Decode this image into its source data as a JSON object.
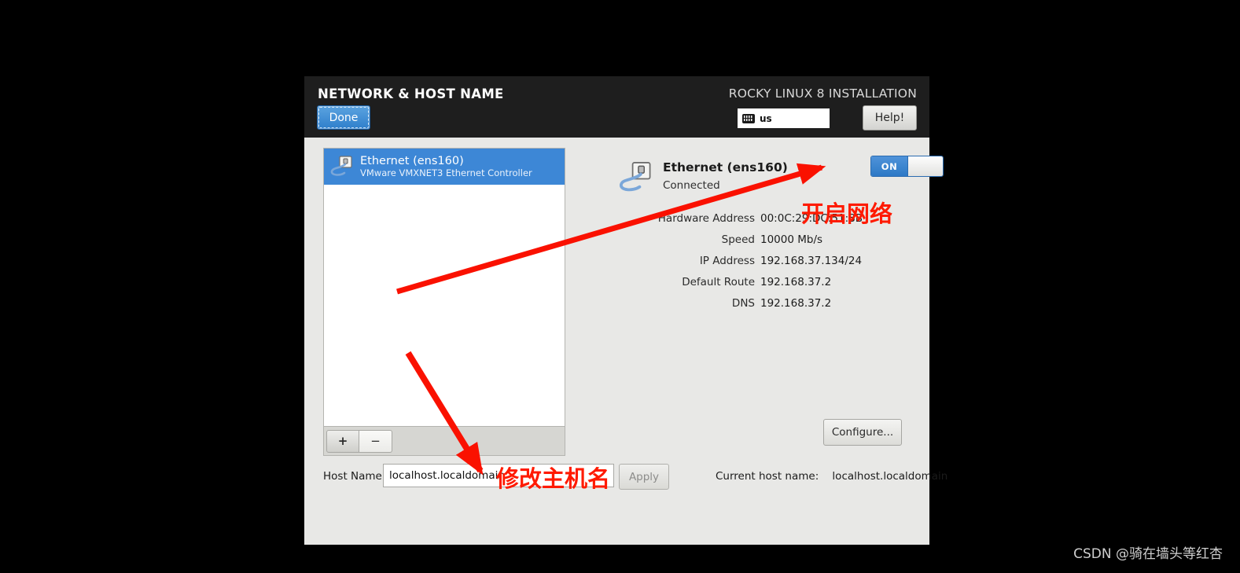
{
  "header": {
    "page_title": "NETWORK & HOST NAME",
    "done_label": "Done",
    "install_title": "ROCKY LINUX 8 INSTALLATION",
    "keyboard_layout": "us",
    "keyboard_icon": "keyboard-icon",
    "help_label": "Help!"
  },
  "device_list": {
    "devices": [
      {
        "name": "Ethernet (ens160)",
        "description": "VMware VMXNET3 Ethernet Controller",
        "icon": "ethernet-icon",
        "selected": true
      }
    ],
    "add_label": "+",
    "remove_label": "−"
  },
  "detail": {
    "icon": "ethernet-icon",
    "title": "Ethernet (ens160)",
    "status": "Connected",
    "toggle_state": "ON",
    "rows": [
      {
        "label": "Hardware Address",
        "value": "00:0C:29:DC:51:8B"
      },
      {
        "label": "Speed",
        "value": "10000 Mb/s"
      },
      {
        "label": "IP Address",
        "value": "192.168.37.134/24"
      },
      {
        "label": "Default Route",
        "value": "192.168.37.2"
      },
      {
        "label": "DNS",
        "value": "192.168.37.2"
      }
    ],
    "configure_label": "Configure..."
  },
  "hostname": {
    "label": "Host Name:",
    "value": "localhost.localdomain",
    "placeholder": "localhost.localdomain",
    "apply_label": "Apply",
    "current_label": "Current host name:",
    "current_value": "localhost.localdomain"
  },
  "annotations": {
    "network_text": "开启网络",
    "hostname_text": "修改主机名",
    "arrow_color": "#fa1100"
  },
  "watermark": "CSDN @骑在墙头等红杏",
  "colors": {
    "header_bg": "#1e1e1e",
    "body_bg": "#e8e8e6",
    "accent_blue": "#3d87d6",
    "annotation_red": "#ff1a00"
  }
}
